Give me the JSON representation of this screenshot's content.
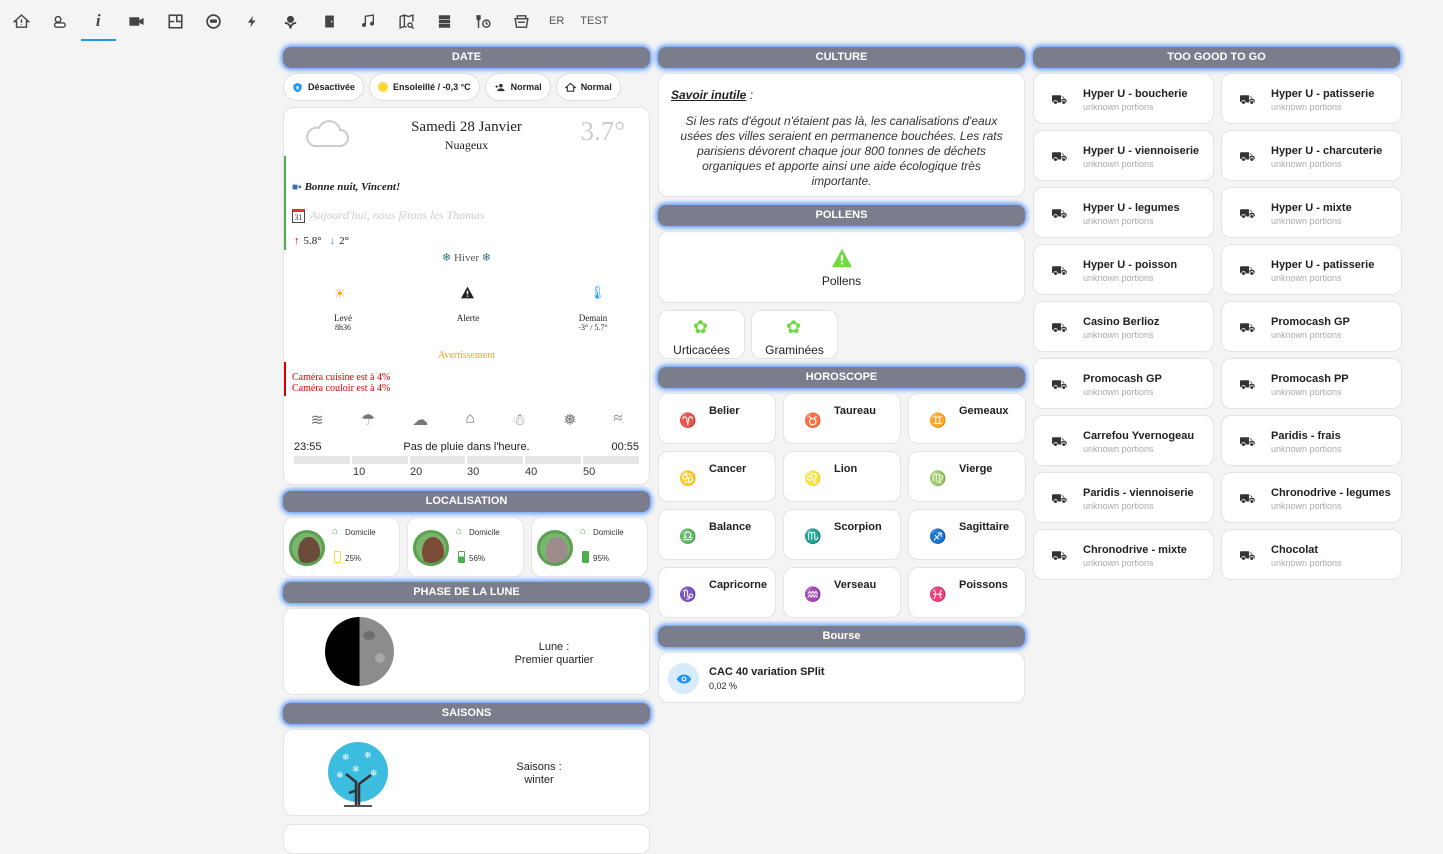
{
  "topbar": {
    "icons": [
      "home-alert-icon",
      "weather-icon",
      "info-icon",
      "camera-icon",
      "floorplan-icon",
      "robot-vacuum-icon",
      "flash-icon",
      "flower-icon",
      "door-icon",
      "music-icon",
      "map-search-icon",
      "server-icon",
      "tools-icon",
      "feeder-icon"
    ],
    "tabs": [
      "ER",
      "TEST"
    ]
  },
  "date": {
    "header": "DATE",
    "chips": [
      "Désactivée",
      "Ensoleillé / -0,3 °C",
      "Normal",
      "Normal"
    ],
    "day": "Samedi 28 Janvier",
    "condition": "Nuageux",
    "temp": "3.7°",
    "greeting": "Bonne nuit, Vincent!",
    "fete": "Aujourd'hui, nous fêtons les Thomas",
    "temp_high": "5.8°",
    "temp_low": "2°",
    "season": "Hiver",
    "cal_num": "31",
    "lbl_leve": "Levé",
    "val_leve": "8h36",
    "lbl_alerte": "Alerte",
    "lbl_demain": "Demain",
    "val_demain": "-3° / 5.7°",
    "warn": "Avertissement",
    "cam1": "Caméra cuisine est à 4%",
    "cam2": "Caméra couloir est à 4%",
    "rain_start": "23:55",
    "rain_text": "Pas de pluie dans l'heure.",
    "rain_end": "00:55",
    "ticks": [
      "10",
      "20",
      "30",
      "40",
      "50"
    ]
  },
  "loc": {
    "header": "LOCALISATION",
    "people": [
      {
        "status": "Domicile",
        "battery": "25%"
      },
      {
        "status": "Domicile",
        "battery": "56%"
      },
      {
        "status": "Domicile",
        "battery": "95%"
      }
    ]
  },
  "moon": {
    "header": "PHASE DE LA LUNE",
    "label": "Lune :",
    "value": "Premier quartier"
  },
  "seasons": {
    "header": "SAISONS",
    "label": "Saisons :",
    "value": "winter"
  },
  "culture": {
    "header": "CULTURE",
    "title": "Savoir inutile",
    "colon": " :",
    "text": "Si les rats d'égout n'étaient pas là, les canalisations d'eaux usées des villes seraient en permanence bouchées. Les rats parisiens dévorent chaque jour 800 tonnes de déchets organiques et apporte ainsi une aide écologique très importante."
  },
  "pollens": {
    "header": "POLLENS",
    "label": "Pollens",
    "items": [
      "Urticacées",
      "Graminées"
    ]
  },
  "horoscope": {
    "header": "HOROSCOPE",
    "signs": [
      {
        "sym": "♈",
        "name": "Belier"
      },
      {
        "sym": "♉",
        "name": "Taureau"
      },
      {
        "sym": "♊",
        "name": "Gemeaux"
      },
      {
        "sym": "♋",
        "name": "Cancer"
      },
      {
        "sym": "♌",
        "name": "Lion"
      },
      {
        "sym": "♍",
        "name": "Vierge"
      },
      {
        "sym": "♎",
        "name": "Balance"
      },
      {
        "sym": "♏",
        "name": "Scorpion"
      },
      {
        "sym": "♐",
        "name": "Sagittaire"
      },
      {
        "sym": "♑",
        "name": "Capricorne"
      },
      {
        "sym": "♒",
        "name": "Verseau"
      },
      {
        "sym": "♓",
        "name": "Poissons"
      }
    ]
  },
  "bourse": {
    "header": "Bourse",
    "name": "CAC 40 variation SPlit",
    "value": "0,02 %"
  },
  "tgtg": {
    "header": "TOO GOOD TO GO",
    "sub": "unknown portions",
    "items": [
      "Hyper U - boucherie",
      "Hyper U - patisserie",
      "Hyper U - viennoiserie",
      "Hyper U - charcuterie",
      "Hyper U - legumes",
      "Hyper U - mixte",
      "Hyper U - poisson",
      "Hyper U - patisserie",
      "Casino Berlioz",
      "Promocash GP",
      "Promocash GP",
      "Promocash PP",
      "Carrefou Yvernogeau",
      "Paridis - frais",
      "Paridis - viennoiserie",
      "Chronodrive - legumes",
      "Chronodrive - mixte",
      "Chocolat"
    ]
  },
  "colors": {
    "accent": "#2196f3",
    "header_bg": "#7b7d8c",
    "pollen_green": "#6cdb3f",
    "home_green": "#4caf50",
    "warn_orange": "#f5a623",
    "alert_red": "#e00000"
  }
}
